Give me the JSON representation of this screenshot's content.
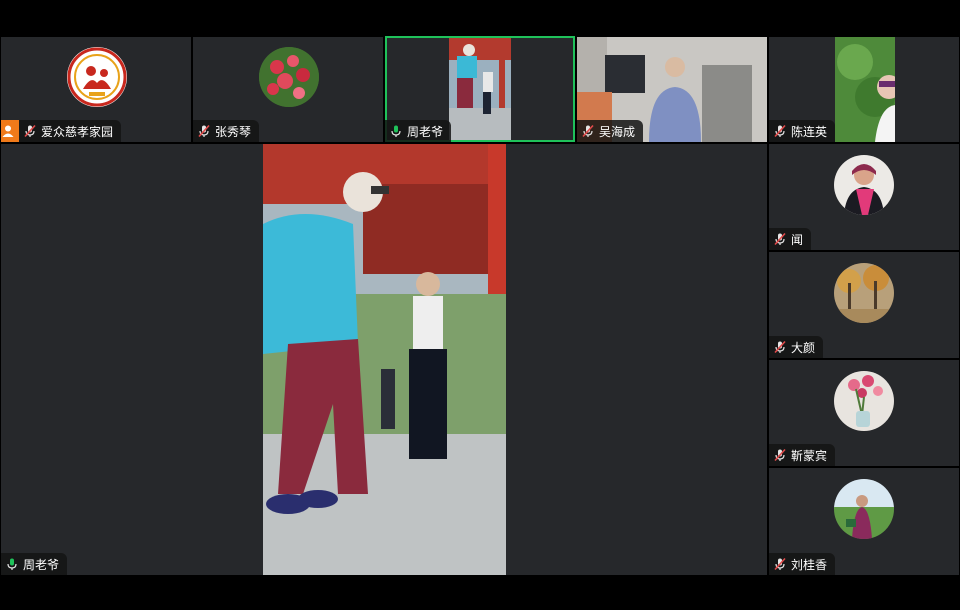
{
  "colors": {
    "background": "#000000",
    "tile": "#26282b",
    "active_border": "#1fc25a",
    "host_badge": "#f07a1a",
    "mic_active": "#1fc25a",
    "mic_muted": "#e14a4a"
  },
  "top_strip": [
    {
      "name": "爱众慈孝家园",
      "host": true,
      "mic": "muted"
    },
    {
      "name": "张秀琴",
      "mic": "muted"
    },
    {
      "name": "周老爷",
      "mic": "active",
      "active_speaker": true
    },
    {
      "name": "吴海成",
      "mic": "muted"
    },
    {
      "name": "陈连英",
      "mic": "muted"
    }
  ],
  "main_view": {
    "name": "周老爷",
    "mic": "active"
  },
  "side_list": [
    {
      "name": "闻",
      "mic": "muted"
    },
    {
      "name": "大颜",
      "mic": "muted"
    },
    {
      "name": "靳蒙宾",
      "mic": "muted"
    },
    {
      "name": "刘桂香",
      "mic": "muted"
    }
  ]
}
